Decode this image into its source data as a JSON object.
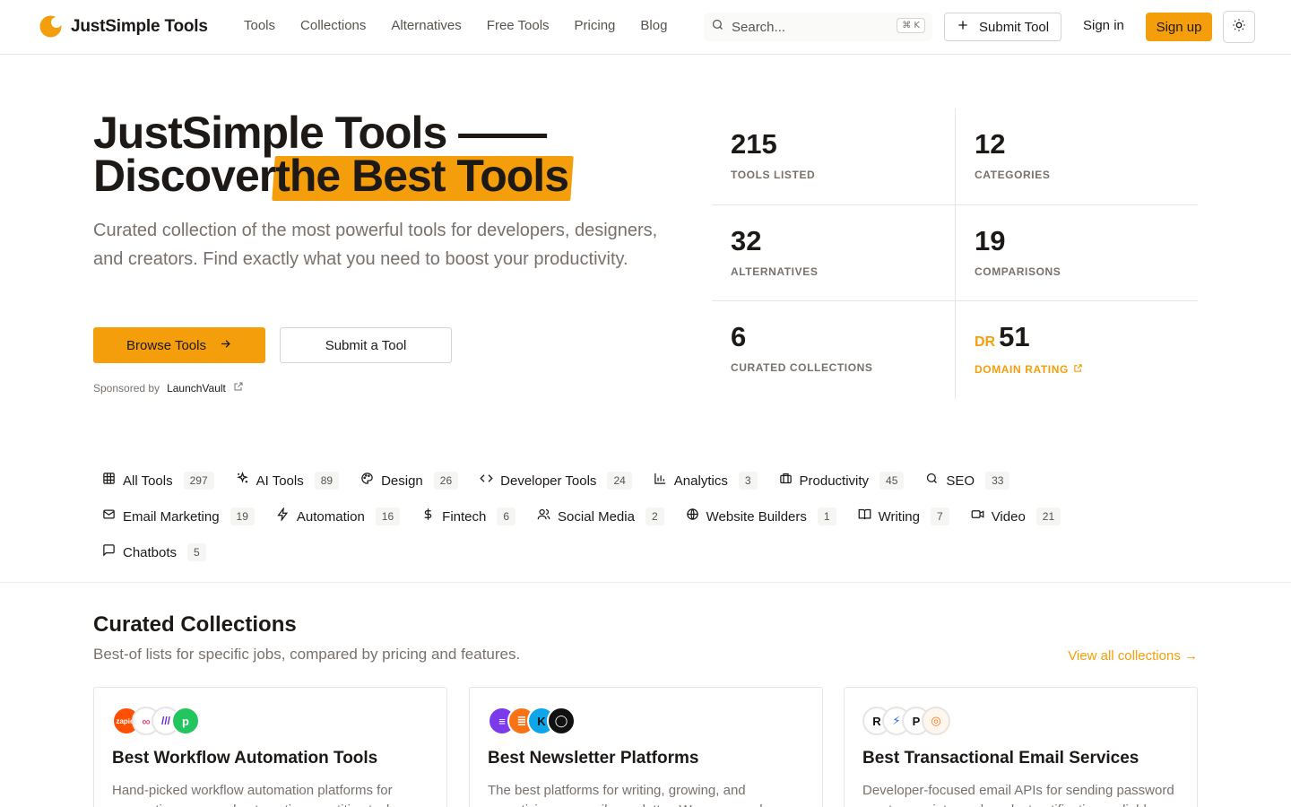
{
  "header": {
    "brand": "JustSimple Tools",
    "nav": [
      "Tools",
      "Collections",
      "Alternatives",
      "Free Tools",
      "Pricing",
      "Blog"
    ],
    "search_placeholder": "Search...",
    "search_shortcut": "⌘ K",
    "submit_label": "Submit Tool",
    "signin_label": "Sign in",
    "signup_label": "Sign up",
    "accent_color": "#f59e0b"
  },
  "hero": {
    "title_line1": "JustSimple Tools ——",
    "title_line2_prefix": "Discover",
    "title_line2_highlight": "the Best Tools",
    "subtitle": "Curated collection of the most powerful tools for developers, designers, and creators. Find exactly what you need to boost your productivity.",
    "browse_label": "Browse Tools",
    "submit_label": "Submit a Tool",
    "sponsored_prefix": "Sponsored by",
    "sponsor_name": "LaunchVault"
  },
  "stats": [
    {
      "value": "215",
      "label": "TOOLS LISTED"
    },
    {
      "value": "12",
      "label": "CATEGORIES"
    },
    {
      "value": "32",
      "label": "ALTERNATIVES"
    },
    {
      "value": "19",
      "label": "COMPARISONS"
    },
    {
      "value": "6",
      "label": "CURATED COLLECTIONS"
    },
    {
      "value": "51",
      "prefix": "DR",
      "label": "DOMAIN RATING"
    }
  ],
  "categories": [
    {
      "label": "All Tools",
      "count": "297",
      "icon": "grid-icon"
    },
    {
      "label": "AI Tools",
      "count": "89",
      "icon": "sparkles-icon"
    },
    {
      "label": "Design",
      "count": "26",
      "icon": "palette-icon"
    },
    {
      "label": "Developer Tools",
      "count": "24",
      "icon": "code-icon"
    },
    {
      "label": "Analytics",
      "count": "3",
      "icon": "bar-chart-icon"
    },
    {
      "label": "Productivity",
      "count": "45",
      "icon": "briefcase-icon"
    },
    {
      "label": "SEO",
      "count": "33",
      "icon": "search-icon"
    },
    {
      "label": "Email Marketing",
      "count": "19",
      "icon": "mail-icon"
    },
    {
      "label": "Automation",
      "count": "16",
      "icon": "zap-icon"
    },
    {
      "label": "Fintech",
      "count": "6",
      "icon": "dollar-icon"
    },
    {
      "label": "Social Media",
      "count": "2",
      "icon": "users-icon"
    },
    {
      "label": "Website Builders",
      "count": "1",
      "icon": "globe-icon"
    },
    {
      "label": "Writing",
      "count": "7",
      "icon": "book-icon"
    },
    {
      "label": "Video",
      "count": "21",
      "icon": "video-icon"
    },
    {
      "label": "Chatbots",
      "count": "5",
      "icon": "message-icon"
    }
  ],
  "collections": {
    "title": "Curated Collections",
    "subtitle": "Best-of lists for specific jobs, compared by pricing and features.",
    "view_all": "View all collections →",
    "cards": [
      {
        "title": "Best Workflow Automation Tools",
        "description": "Hand-picked workflow automation platforms for connecting apps and automating repetitive tasks.",
        "logos": [
          {
            "text": "zapier",
            "color": "#ff4f00"
          },
          {
            "text": "∞",
            "color": "#ffffff"
          },
          {
            "text": "///",
            "color": "#6d28d9"
          },
          {
            "text": "p",
            "color": "#22c55e"
          }
        ]
      },
      {
        "title": "Best Newsletter Platforms",
        "description": "The best platforms for writing, growing, and monetizing an email newsletter. We compared publishing features.",
        "logos": [
          {
            "text": "≡",
            "color": "#7c3aed"
          },
          {
            "text": "≣",
            "color": "#f97316"
          },
          {
            "text": "K",
            "color": "#0ea5e9"
          },
          {
            "text": "◯",
            "color": "#111111"
          }
        ]
      },
      {
        "title": "Best Transactional Email Services",
        "description": "Developer-focused email APIs for sending password resets, receipts, and product notifications reliably.",
        "logos": [
          {
            "text": "R",
            "color": "#ffffff"
          },
          {
            "text": "⚡",
            "color": "#ffffff"
          },
          {
            "text": "P",
            "color": "#ffffff"
          },
          {
            "text": "◎",
            "color": "#fff7ed"
          }
        ]
      }
    ]
  }
}
